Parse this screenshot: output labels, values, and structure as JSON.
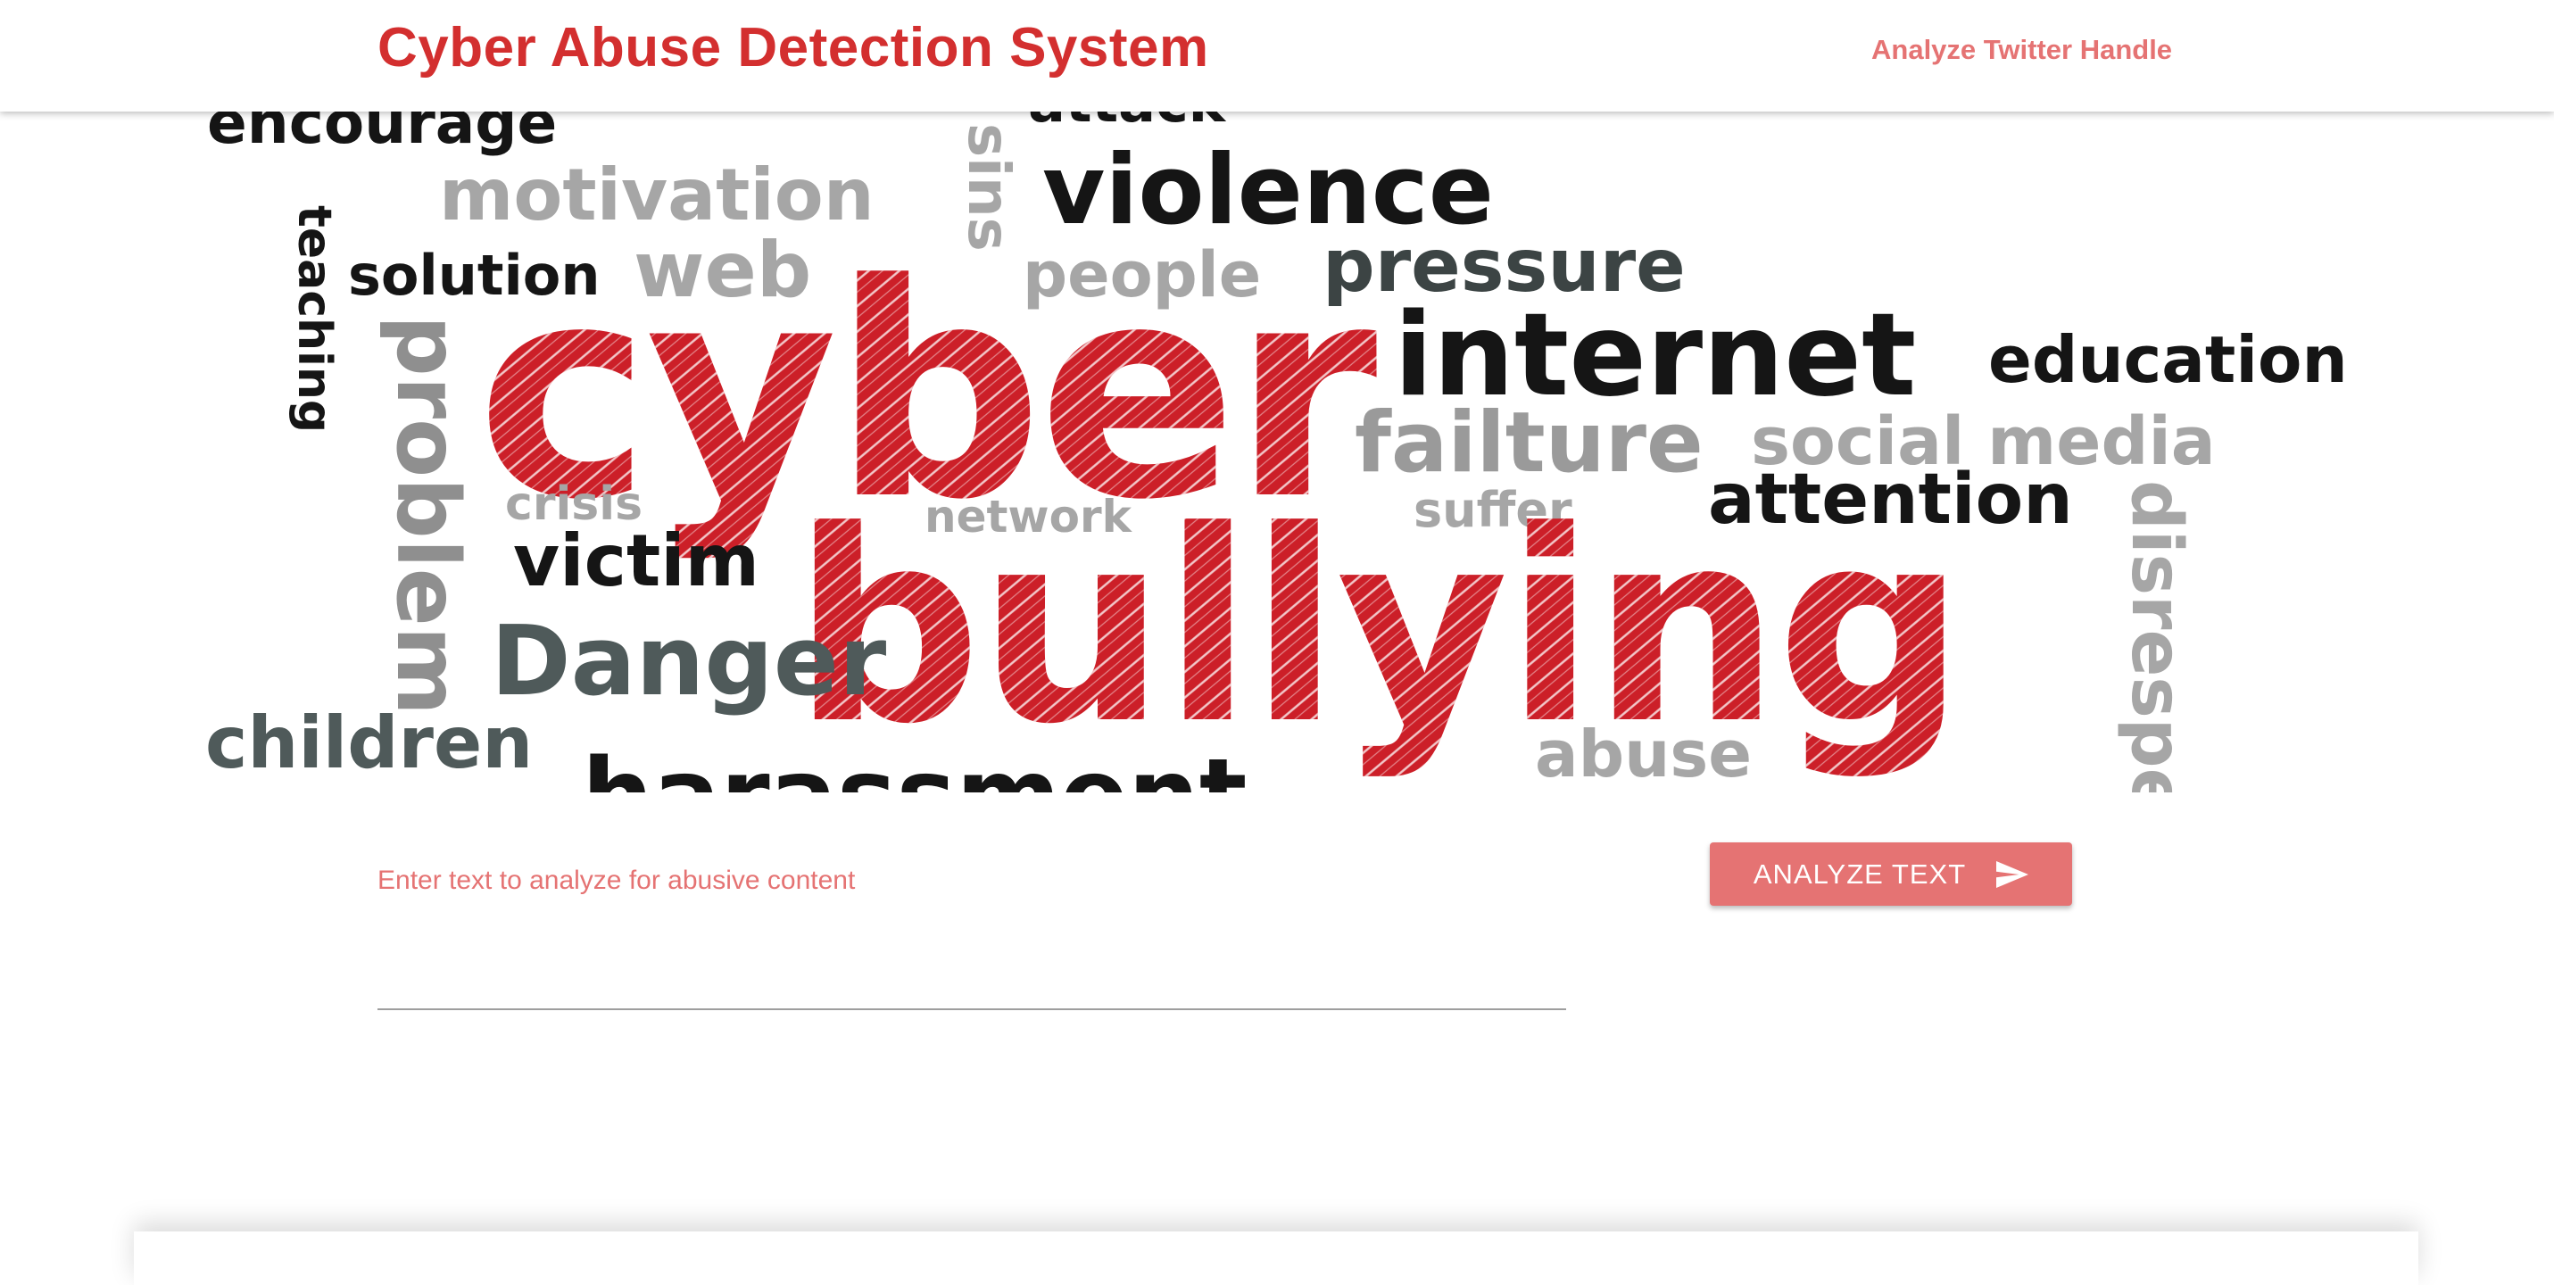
{
  "header": {
    "title": "Cyber Abuse Detection System",
    "nav_link": "Analyze Twitter Handle"
  },
  "banner": {
    "words": {
      "encourage": "encourage",
      "attack": "attack",
      "motivation": "motivation",
      "violence": "violence",
      "sins": "sins",
      "teaching": "teaching",
      "solution": "solution",
      "web": "web",
      "people": "people",
      "pressure": "pressure",
      "cyber": "cyber",
      "internet": "internet",
      "education": "education",
      "problem": "problem",
      "failture": "failture",
      "social_media": "social media",
      "crisis": "crisis",
      "network": "network",
      "suffer": "suffer",
      "attention": "attention",
      "victim": "victim",
      "bullying": "bullying",
      "disrespect": "disrespect",
      "danger": "Danger",
      "children": "children",
      "harassment": "harassment",
      "abuse": "abuse"
    }
  },
  "form": {
    "label": "Enter text to analyze for abusive content",
    "value": "",
    "button_label": "ANALYZE TEXT"
  },
  "colors": {
    "title": "#d32f2f",
    "accent": "#e57373",
    "cloud_red": "#cc1f28",
    "cloud_black": "#151515",
    "cloud_gray": "#a6a6a6",
    "cloud_slate": "#4f5a5a"
  },
  "icons": {
    "button_icon": "send-icon"
  }
}
